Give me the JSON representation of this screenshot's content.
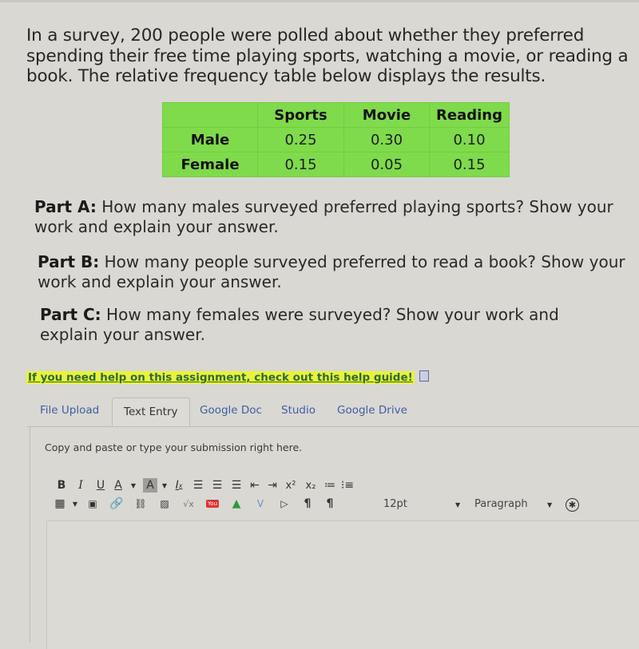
{
  "assignment": {
    "intro": "In a survey, 200 people were polled about whether they preferred spending their free time playing sports, watching a movie, or reading a book. The relative frequency table below displays the results.",
    "table": {
      "columns": [
        "",
        "Sports",
        "Movie",
        "Reading"
      ],
      "rows": [
        {
          "label": "Male",
          "values": [
            "0.25",
            "0.30",
            "0.10"
          ]
        },
        {
          "label": "Female",
          "values": [
            "0.15",
            "0.05",
            "0.15"
          ]
        }
      ],
      "background_color": "#7fdb4b"
    },
    "parts": [
      {
        "label": "Part A:",
        "text": " How many males surveyed preferred playing sports? Show your work and explain your answer."
      },
      {
        "label": "Part B:",
        "text": " How many people surveyed preferred to read a book? Show your work and explain your answer."
      },
      {
        "label": "Part C:",
        "text": " How many females were surveyed? Show your work and explain your answer."
      }
    ]
  },
  "help_link": {
    "text": "If you need help on this assignment, check out this help guide!",
    "highlight_color": "#e8f33a",
    "icon": "document-icon"
  },
  "submission": {
    "tabs": [
      {
        "label": "File Upload",
        "active": false
      },
      {
        "label": "Text Entry",
        "active": true
      },
      {
        "label": "Google Doc",
        "active": false
      },
      {
        "label": "Studio",
        "active": false
      },
      {
        "label": "Google Drive",
        "active": false
      }
    ],
    "instructions": "Copy and paste or type your submission right here.",
    "toolbar": {
      "row1": [
        "bold",
        "italic",
        "underline",
        "text-color",
        "background-color",
        "clear-formatting",
        "align-left",
        "align-center",
        "align-right",
        "outdent",
        "indent",
        "superscript",
        "subscript",
        "bullet-list",
        "numbered-list"
      ],
      "row2": [
        "table",
        "media",
        "link",
        "unlink",
        "image",
        "equation",
        "youtube",
        "google-drive",
        "vimeo",
        "embed",
        "ltr",
        "rtl"
      ],
      "font_size": "12pt",
      "block_format": "Paragraph",
      "accessibility": "accessibility-checker"
    },
    "editor_value": ""
  }
}
